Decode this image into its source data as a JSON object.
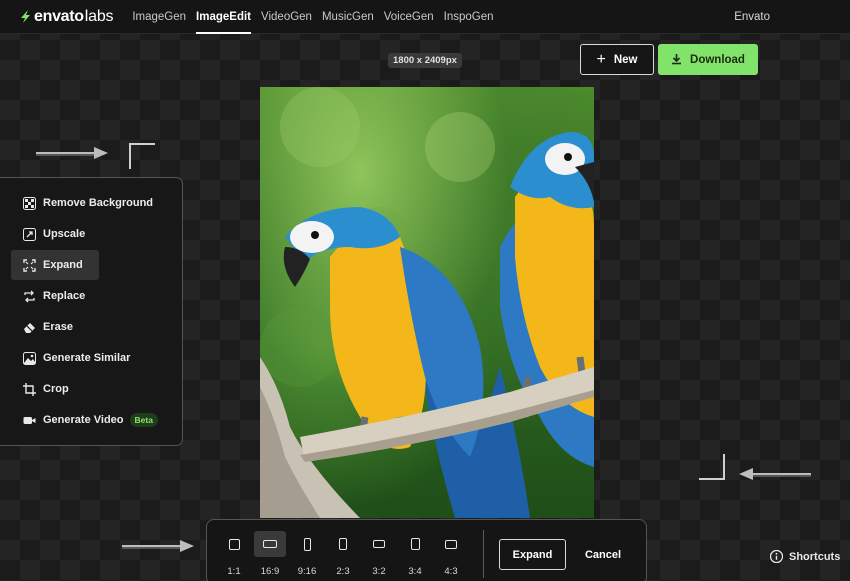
{
  "brand": {
    "name": "envato",
    "suffix": "labs",
    "accent": "#82e36a"
  },
  "nav": {
    "items": [
      {
        "label": "ImageGen",
        "active": false
      },
      {
        "label": "ImageEdit",
        "active": true
      },
      {
        "label": "VideoGen",
        "active": false
      },
      {
        "label": "MusicGen",
        "active": false
      },
      {
        "label": "VoiceGen",
        "active": false
      },
      {
        "label": "InspoGen",
        "active": false
      }
    ],
    "account": "Envato"
  },
  "canvas": {
    "dimensions": "1800 x 2409px"
  },
  "actions": {
    "new_label": "New",
    "download_label": "Download"
  },
  "tools": [
    {
      "label": "Remove Background",
      "icon": "checker-icon",
      "active": false
    },
    {
      "label": "Upscale",
      "icon": "upscale-icon",
      "active": false
    },
    {
      "label": "Expand",
      "icon": "expand-icon",
      "active": true
    },
    {
      "label": "Replace",
      "icon": "replace-icon",
      "active": false
    },
    {
      "label": "Erase",
      "icon": "eraser-icon",
      "active": false
    },
    {
      "label": "Generate Similar",
      "icon": "image-icon",
      "active": false
    },
    {
      "label": "Crop",
      "icon": "crop-icon",
      "active": false
    },
    {
      "label": "Generate Video",
      "icon": "video-icon",
      "active": false,
      "badge": "Beta"
    }
  ],
  "aspect_ratios": [
    {
      "label": "1:1",
      "active": false
    },
    {
      "label": "16:9",
      "active": true
    },
    {
      "label": "9:16",
      "active": false
    },
    {
      "label": "2:3",
      "active": false
    },
    {
      "label": "3:2",
      "active": false
    },
    {
      "label": "3:4",
      "active": false
    },
    {
      "label": "4:3",
      "active": false
    }
  ],
  "expand_bar": {
    "expand_label": "Expand",
    "cancel_label": "Cancel"
  },
  "shortcuts_label": "Shortcuts"
}
